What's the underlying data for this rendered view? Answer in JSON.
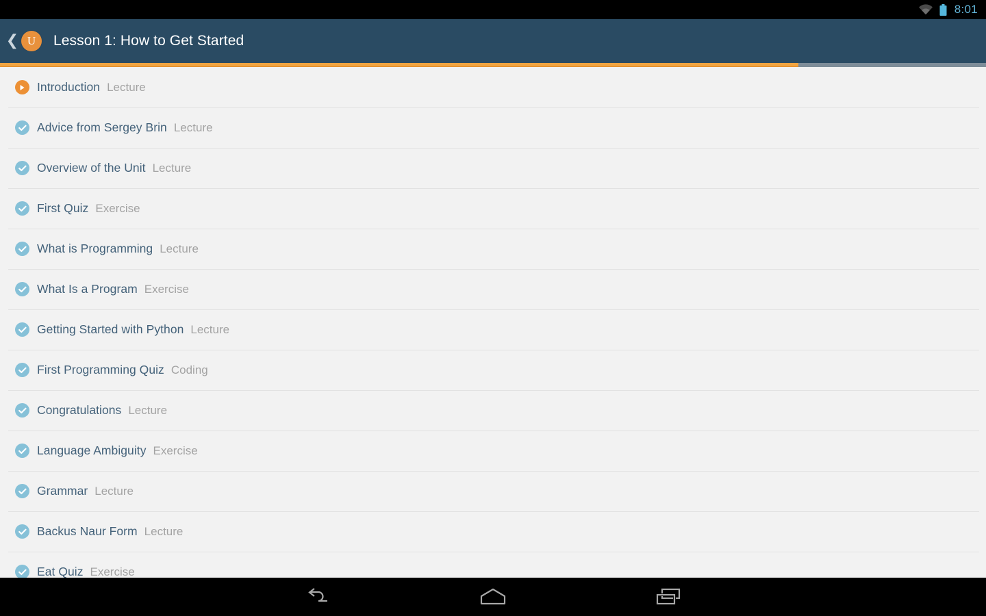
{
  "status_bar": {
    "wifi_icon": "wifi-icon",
    "battery_icon": "battery-icon",
    "clock": "8:01",
    "clock_color": "#61b3d6",
    "background": "#000000"
  },
  "app_bar": {
    "back_icon": "back-chevron-icon",
    "logo_letter": "U",
    "logo_name": "udacity-logo",
    "title": "Lesson 1: How to Get Started",
    "background": "#2a4b63",
    "accent": "#e8913c"
  },
  "progress": {
    "percent": 81,
    "fill_color": "#f0a441",
    "track_color": "#7e8d99"
  },
  "list": {
    "items": [
      {
        "title": "Introduction",
        "kind": "Lecture",
        "state": "play"
      },
      {
        "title": "Advice from Sergey Brin",
        "kind": "Lecture",
        "state": "done"
      },
      {
        "title": "Overview of the Unit",
        "kind": "Lecture",
        "state": "done"
      },
      {
        "title": "First Quiz",
        "kind": "Exercise",
        "state": "done"
      },
      {
        "title": "What is Programming",
        "kind": "Lecture",
        "state": "done"
      },
      {
        "title": "What Is a Program",
        "kind": "Exercise",
        "state": "done"
      },
      {
        "title": "Getting Started with Python",
        "kind": "Lecture",
        "state": "done"
      },
      {
        "title": "First Programming Quiz",
        "kind": "Coding",
        "state": "done"
      },
      {
        "title": "Congratulations",
        "kind": "Lecture",
        "state": "done"
      },
      {
        "title": "Language Ambiguity",
        "kind": "Exercise",
        "state": "done"
      },
      {
        "title": "Grammar",
        "kind": "Lecture",
        "state": "done"
      },
      {
        "title": "Backus Naur Form",
        "kind": "Lecture",
        "state": "done"
      },
      {
        "title": "Eat Quiz",
        "kind": "Exercise",
        "state": "done"
      }
    ],
    "play_icon_color": "#ec9035",
    "done_icon_color": "#86c1d8",
    "title_color": "#44627a",
    "kind_color": "#a3a3a3",
    "background": "#f2f2f2"
  },
  "nav_bar": {
    "background": "#000000",
    "buttons": [
      {
        "name": "back-button",
        "icon": "back-arrow-icon"
      },
      {
        "name": "home-button",
        "icon": "home-icon"
      },
      {
        "name": "recents-button",
        "icon": "recents-icon"
      }
    ]
  }
}
